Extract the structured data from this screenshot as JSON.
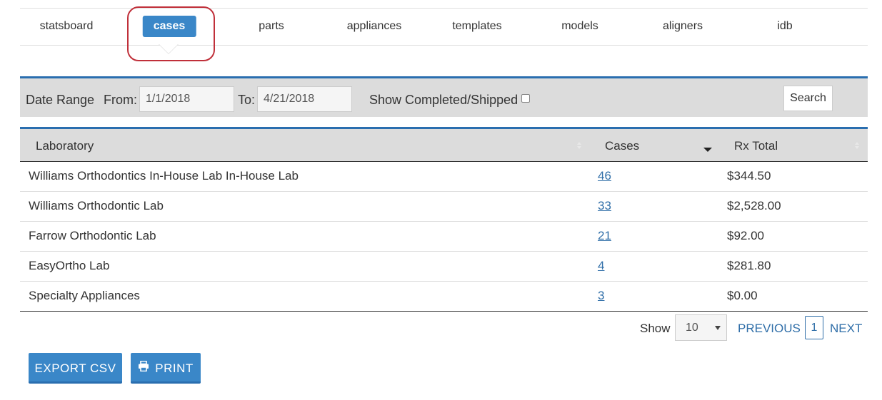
{
  "nav": {
    "tabs": [
      {
        "label": "statsboard"
      },
      {
        "label": "cases",
        "active": true
      },
      {
        "label": "parts"
      },
      {
        "label": "appliances"
      },
      {
        "label": "templates"
      },
      {
        "label": "models"
      },
      {
        "label": "aligners"
      },
      {
        "label": "idb"
      }
    ]
  },
  "filters": {
    "date_range_label": "Date Range",
    "from_label": "From:",
    "from_value": "1/1/2018",
    "to_label": "To:",
    "to_value": "4/21/2018",
    "show_completed_label": "Show Completed/Shipped",
    "show_completed_checked": false,
    "search_label": "Search"
  },
  "table": {
    "columns": [
      "Laboratory",
      "Cases",
      "Rx Total"
    ],
    "sorted_column": "Cases",
    "sort_direction": "desc",
    "rows": [
      {
        "laboratory": "Williams Orthodontics In-House Lab In-House Lab",
        "cases": "46",
        "rx_total": "$344.50"
      },
      {
        "laboratory": "Williams Orthodontic Lab",
        "cases": "33",
        "rx_total": "$2,528.00"
      },
      {
        "laboratory": "Farrow Orthodontic Lab",
        "cases": "21",
        "rx_total": "$92.00"
      },
      {
        "laboratory": "EasyOrtho Lab",
        "cases": "4",
        "rx_total": "$281.80"
      },
      {
        "laboratory": "Specialty Appliances",
        "cases": "3",
        "rx_total": "$0.00"
      }
    ]
  },
  "pagination": {
    "show_label": "Show",
    "page_size": "10",
    "previous_label": "PREVIOUS",
    "current_page": "1",
    "next_label": "NEXT"
  },
  "actions": {
    "export_label": "EXPORT CSV",
    "print_label": "PRINT",
    "print_icon": "printer-icon"
  },
  "colors": {
    "accent": "#3a87c8",
    "link": "#2f6ea8",
    "highlight_ring": "#c0303a"
  }
}
